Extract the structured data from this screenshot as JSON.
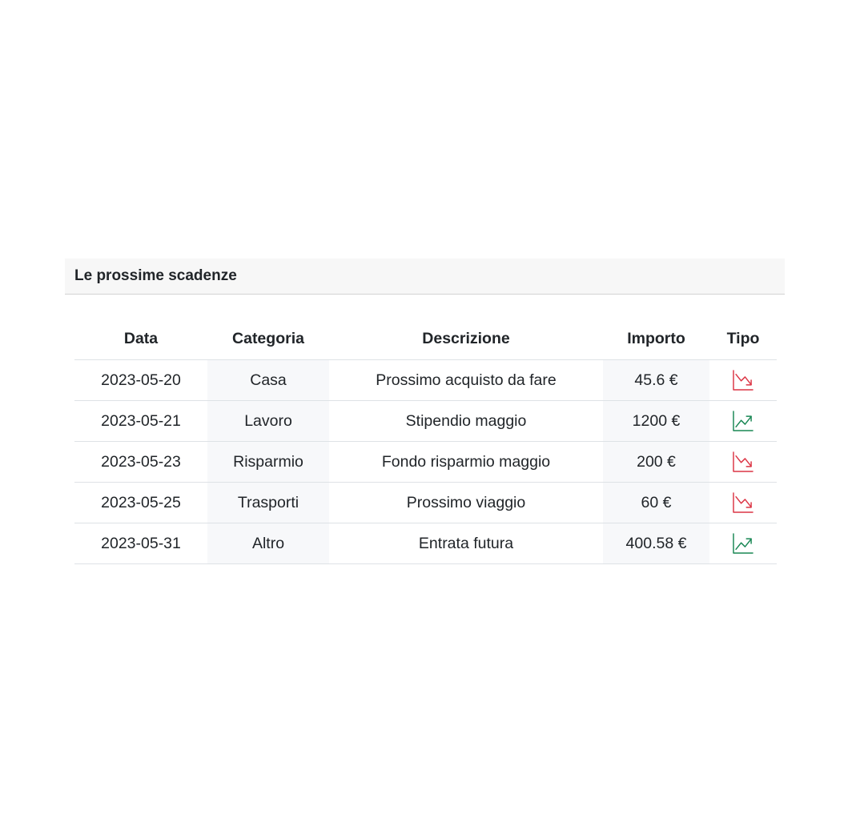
{
  "card": {
    "title": "Le prossime scadenze"
  },
  "table": {
    "headers": {
      "date": "Data",
      "category": "Categoria",
      "description": "Descrizione",
      "amount": "Importo",
      "type": "Tipo"
    },
    "rows": [
      {
        "date": "2023-05-20",
        "category": "Casa",
        "description": "Prossimo acquisto da fare",
        "amount": "45.6 €",
        "type_icon": "trend-down-icon"
      },
      {
        "date": "2023-05-21",
        "category": "Lavoro",
        "description": "Stipendio maggio",
        "amount": "1200 €",
        "type_icon": "trend-up-icon"
      },
      {
        "date": "2023-05-23",
        "category": "Risparmio",
        "description": "Fondo risparmio maggio",
        "amount": "200 €",
        "type_icon": "trend-down-icon"
      },
      {
        "date": "2023-05-25",
        "category": "Trasporti",
        "description": "Prossimo viaggio",
        "amount": "60 €",
        "type_icon": "trend-down-icon"
      },
      {
        "date": "2023-05-31",
        "category": "Altro",
        "description": "Entrata futura",
        "amount": "400.58 €",
        "type_icon": "trend-up-icon"
      }
    ]
  },
  "colors": {
    "expense": "#dc3545",
    "income": "#198754",
    "shaded_column": "#f7f8fa",
    "header_bg": "#f7f7f7"
  }
}
